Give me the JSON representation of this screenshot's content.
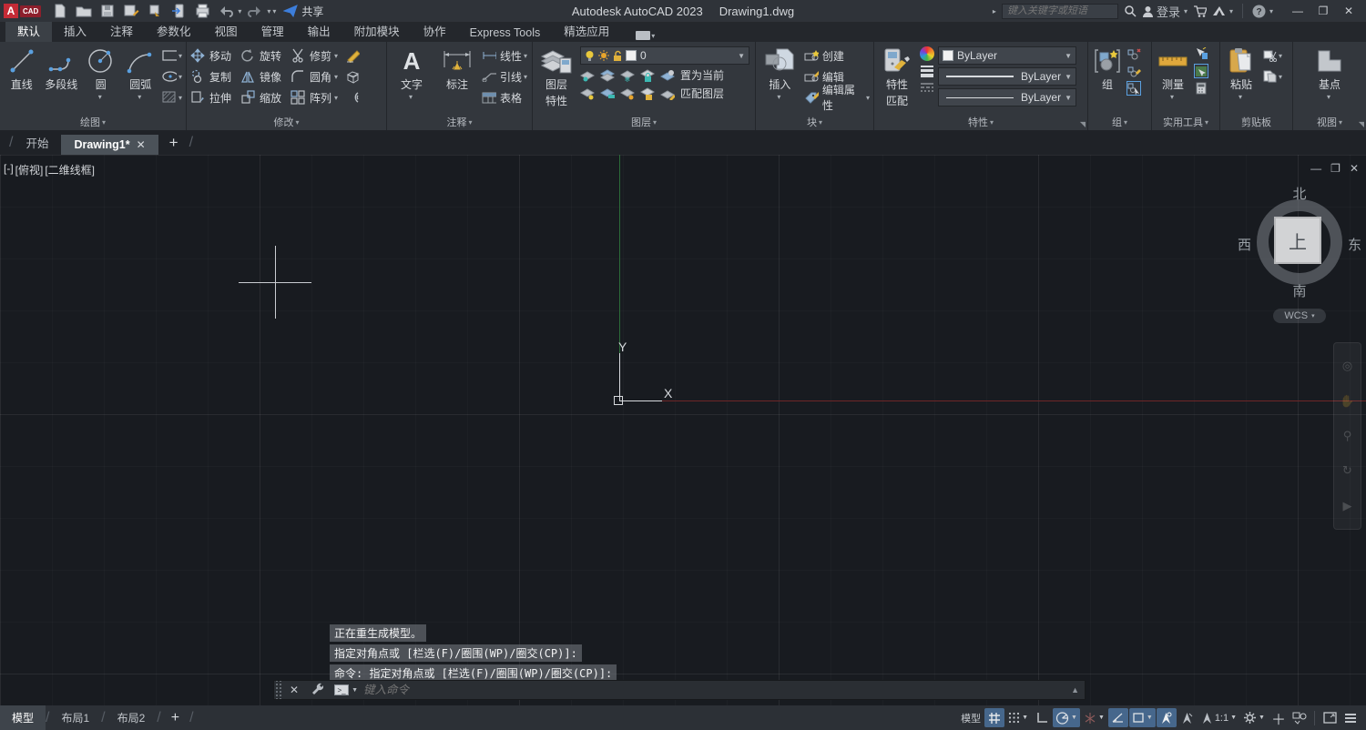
{
  "titlebar": {
    "app_title": "Autodesk AutoCAD 2023",
    "doc_title": "Drawing1.dwg",
    "search_placeholder": "键入关键字或短语",
    "signin_label": "登录",
    "share_label": "共享",
    "icons": [
      "autocad-logo",
      "new-file-icon",
      "open-folder-icon",
      "save-icon",
      "save-as-icon",
      "plot-icon",
      "print-icon",
      "undo-icon",
      "redo-icon",
      "customize-caret-icon",
      "share-plane-icon",
      "search-icon",
      "user-icon",
      "cart-icon",
      "autodesk-icon",
      "help-icon"
    ]
  },
  "ribbon_tabs": {
    "items": [
      {
        "label": "默认"
      },
      {
        "label": "插入"
      },
      {
        "label": "注释"
      },
      {
        "label": "参数化"
      },
      {
        "label": "视图"
      },
      {
        "label": "管理"
      },
      {
        "label": "输出"
      },
      {
        "label": "附加模块"
      },
      {
        "label": "协作"
      },
      {
        "label": "Express Tools"
      },
      {
        "label": "精选应用"
      }
    ]
  },
  "panels": {
    "draw": {
      "label": "绘图",
      "line": "直线",
      "polyline": "多段线",
      "circle": "圆",
      "arc": "圆弧"
    },
    "modify": {
      "label": "修改",
      "move": "移动",
      "rotate": "旋转",
      "trim": "修剪",
      "copy": "复制",
      "mirror": "镜像",
      "fillet": "圆角",
      "stretch": "拉伸",
      "scale": "缩放",
      "array": "阵列"
    },
    "annotation": {
      "label": "注释",
      "text": "文字",
      "dimension": "标注",
      "linear": "线性",
      "leader": "引线",
      "table": "表格"
    },
    "layers": {
      "label": "图层",
      "properties_line1": "图层",
      "properties_line2": "特性",
      "current_layer": "0",
      "set_current": "置为当前",
      "match_layer": "匹配图层"
    },
    "block": {
      "label": "块",
      "insert": "插入",
      "create": "创建",
      "edit": "编辑",
      "edit_attributes": "编辑属性"
    },
    "properties": {
      "label": "特性",
      "match_line1": "特性",
      "match_line2": "匹配",
      "color_value": "ByLayer",
      "lineweight_value": "ByLayer",
      "linetype_value": "ByLayer"
    },
    "groups": {
      "label": "组",
      "group": "组"
    },
    "utilities": {
      "label": "实用工具",
      "measure": "测量"
    },
    "clipboard": {
      "label": "剪贴板",
      "paste": "粘贴"
    },
    "view": {
      "label": "视图",
      "base": "基点"
    }
  },
  "file_tabs": {
    "start": "开始",
    "drawing": "Drawing1*"
  },
  "viewport": {
    "minimize_control": "[-]",
    "view_name": "[俯视]",
    "visual_style": "[二维线框]"
  },
  "viewcube": {
    "north": "北",
    "south": "南",
    "west": "西",
    "east": "东",
    "top": "上",
    "wcs": "WCS"
  },
  "command": {
    "history": [
      "正在重生成模型。",
      "指定对角点或 [栏选(F)/圈围(WP)/圈交(CP)]:",
      "命令: 指定对角点或 [栏选(F)/圈围(WP)/圈交(CP)]:"
    ],
    "input_placeholder": "键入命令"
  },
  "statusbar": {
    "layout_tabs": [
      "模型",
      "布局1",
      "布局2"
    ],
    "model_label": "模型",
    "annotation_scale": "1:1"
  },
  "colors": {
    "accent_blue": "#5aa0e0",
    "active_status_blue": "#46678c",
    "axis_red": "#6e2527",
    "axis_green": "#2c6b38",
    "canvas_bg": "#181b20",
    "ribbon_bg": "#33373d",
    "logo_red": "#c42b36"
  }
}
